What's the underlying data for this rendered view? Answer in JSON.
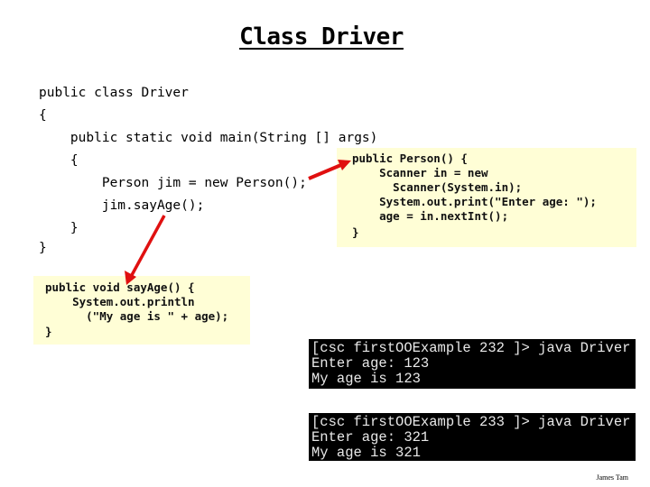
{
  "title": "Class Driver",
  "driver_code": [
    "public class Driver",
    "{",
    "    public static void main(String [] args)",
    "    {",
    "        Person jim = new Person();",
    "        jim.sayAge();",
    "    }",
    "}"
  ],
  "person_constructor_note": [
    "public Person() {",
    "    Scanner in = new",
    "      Scanner(System.in);",
    "    System.out.print(\"Enter age: \");",
    "    age = in.nextInt();",
    "}"
  ],
  "say_age_note": [
    "public void sayAge() {",
    "    System.out.println",
    "      (\"My age is \" + age);",
    "}"
  ],
  "terminal_runs": [
    {
      "lines": [
        "[csc firstOOExample 232 ]> java Driver",
        "Enter age: 123",
        "My age is 123"
      ]
    },
    {
      "lines": [
        "[csc firstOOExample 233 ]> java Driver",
        "Enter age: 321",
        "My age is 321"
      ]
    }
  ],
  "author": "James Tam",
  "colors": {
    "note_background": "#fffed6",
    "arrow": "#e01010",
    "terminal_background": "#000000",
    "terminal_text": "#e8e8e8"
  }
}
